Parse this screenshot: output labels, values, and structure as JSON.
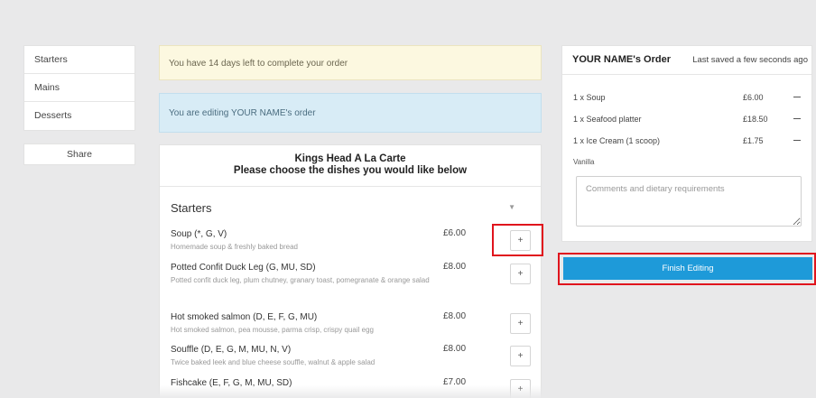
{
  "sidebar": {
    "items": [
      {
        "label": "Starters"
      },
      {
        "label": "Mains"
      },
      {
        "label": "Desserts"
      }
    ],
    "share_label": "Share"
  },
  "banners": {
    "deadline": "You have 14 days left to complete your order",
    "editing": "You are editing YOUR NAME's order"
  },
  "menu": {
    "title_line1": "Kings Head A La Carte",
    "title_line2": "Please choose the dishes you would like below",
    "section": "Starters",
    "dishes": [
      {
        "name": "Soup (*, G, V)",
        "desc": "Homemade soup & freshly baked bread",
        "price": "£6.00",
        "add": "+"
      },
      {
        "name": "Potted Confit Duck Leg (G, MU, SD)",
        "desc": "Potted confit duck leg, plum chutney, granary toast, pomegranate & orange salad",
        "price": "£8.00",
        "add": "+"
      },
      {
        "name": "Hot smoked salmon (D, E, F, G, MU)",
        "desc": "Hot smoked salmon, pea mousse, parma crisp, crispy quail egg",
        "price": "£8.00",
        "add": "+"
      },
      {
        "name": "Souffle (D, E, G, M, MU, N, V)",
        "desc": "Twice baked leek and blue cheese souffle, walnut & apple salad",
        "price": "£8.00",
        "add": "+"
      },
      {
        "name": "Fishcake (E, F, G, M, MU, SD)",
        "desc": "",
        "price": "£7.00",
        "add": "+"
      }
    ]
  },
  "order": {
    "title": "YOUR NAME's Order",
    "saved": "Last saved a few seconds ago",
    "lines": [
      {
        "item": "1 x Soup",
        "price": "£6.00"
      },
      {
        "item": "1 x Seafood platter",
        "price": "£18.50"
      },
      {
        "item": "1 x Ice Cream (1 scoop)",
        "price": "£1.75"
      }
    ],
    "note": "Vanilla",
    "comments_placeholder": "Comments and dietary requirements"
  },
  "finish_label": "Finish Editing",
  "colors": {
    "accent": "#1e9ad9",
    "highlight": "#e0141d"
  }
}
